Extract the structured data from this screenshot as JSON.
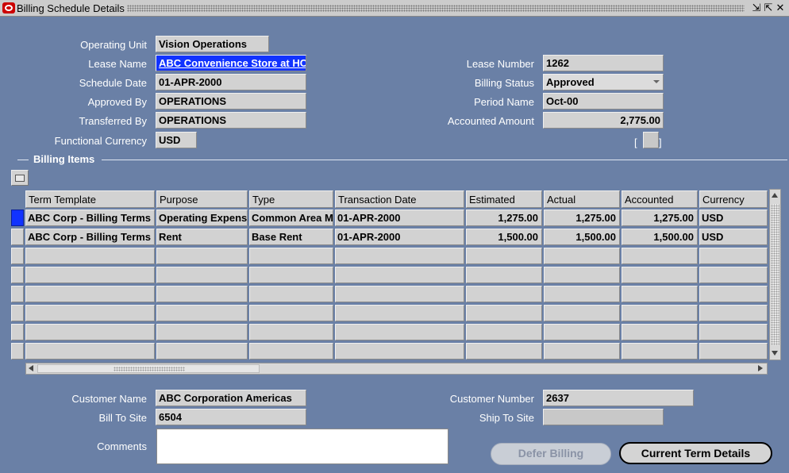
{
  "window": {
    "title": "Billing Schedule Details",
    "controls": [
      "⇲",
      "⇱",
      "✕"
    ]
  },
  "header": {
    "operating_unit": {
      "label": "Operating Unit",
      "value": "Vision Operations"
    },
    "lease_name": {
      "label": "Lease Name",
      "value": "ABC Convenience Store at HC"
    },
    "schedule_date": {
      "label": "Schedule Date",
      "value": "01-APR-2000"
    },
    "approved_by": {
      "label": "Approved By",
      "value": "OPERATIONS"
    },
    "transferred_by": {
      "label": "Transferred By",
      "value": "OPERATIONS"
    },
    "functional_currency": {
      "label": "Functional Currency",
      "value": "USD"
    },
    "lease_number": {
      "label": "Lease Number",
      "value": "1262"
    },
    "billing_status": {
      "label": "Billing Status",
      "value": "Approved"
    },
    "period_name": {
      "label": "Period Name",
      "value": "Oct-00"
    },
    "accounted_amount": {
      "label": "Accounted Amount",
      "value": "2,775.00"
    },
    "dff": {
      "open": "[",
      "close": "]"
    }
  },
  "billing_items": {
    "section_title": "Billing Items",
    "columns": [
      "Term Template",
      "Purpose",
      "Type",
      "Transaction Date",
      "Estimated",
      "Actual",
      "Accounted",
      "Currency"
    ],
    "rows": [
      {
        "term_template": "ABC Corp - Billing Terms",
        "purpose": "Operating Expense",
        "type": "Common Area Maintenance",
        "transaction_date": "01-APR-2000",
        "estimated": "1,275.00",
        "actual": "1,275.00",
        "accounted": "1,275.00",
        "currency": "USD"
      },
      {
        "term_template": "ABC Corp - Billing Terms",
        "purpose": "Rent",
        "type": "Base Rent",
        "transaction_date": "01-APR-2000",
        "estimated": "1,500.00",
        "actual": "1,500.00",
        "accounted": "1,500.00",
        "currency": "USD"
      }
    ]
  },
  "footer": {
    "customer_name": {
      "label": "Customer Name",
      "value": "ABC Corporation Americas"
    },
    "bill_to_site": {
      "label": "Bill To Site",
      "value": "6504"
    },
    "comments": {
      "label": "Comments",
      "value": ""
    },
    "customer_number": {
      "label": "Customer Number",
      "value": "2637"
    },
    "ship_to_site": {
      "label": "Ship To Site",
      "value": ""
    }
  },
  "buttons": {
    "defer_billing": "Defer Billing",
    "current_term_details": "Current Term Details"
  }
}
